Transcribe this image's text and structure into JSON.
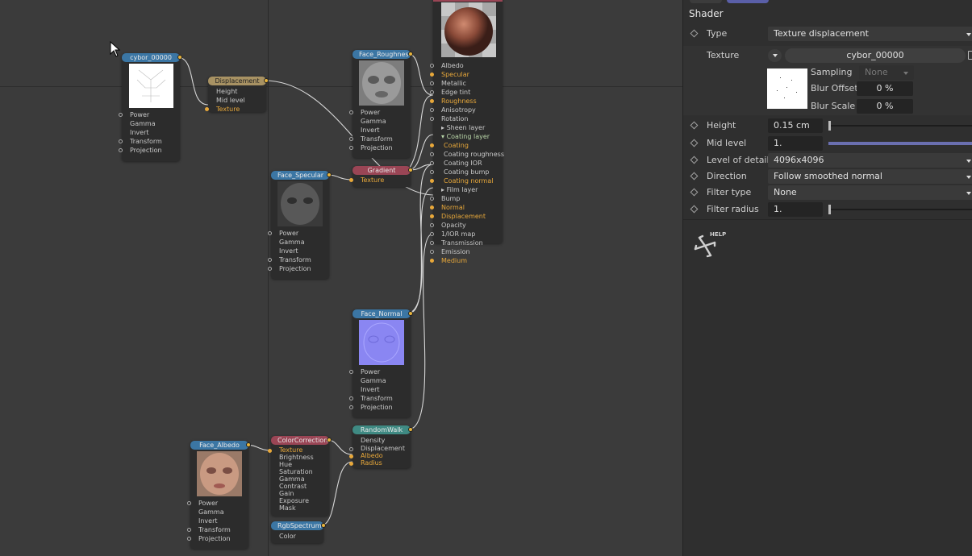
{
  "editor": {
    "nodes": {
      "cybor": {
        "title": "cybor_00000",
        "ports": [
          "Power",
          "Gamma",
          "Invert",
          "Transform",
          "Projection"
        ]
      },
      "displacement": {
        "title": "Displacement",
        "ports": [
          "Height",
          "Mid level",
          "Texture"
        ]
      },
      "face_roughness": {
        "title": "Face_Roughness",
        "ports": [
          "Power",
          "Gamma",
          "Invert",
          "Transform",
          "Projection"
        ]
      },
      "face_specular": {
        "title": "Face_Specular",
        "ports": [
          "Power",
          "Gamma",
          "Invert",
          "Transform",
          "Projection"
        ]
      },
      "gradient": {
        "title": "Gradient",
        "ports": [
          "Texture"
        ]
      },
      "material": {
        "ports": [
          "Albedo",
          "Specular",
          "Metallic",
          "Edge tint",
          "Roughness",
          "Anisotropy",
          "Rotation",
          "Sheen layer",
          "Coating layer",
          "Coating",
          "Coating roughness",
          "Coating IOR",
          "Coating bump",
          "Coating normal",
          "Film layer",
          "Bump",
          "Normal",
          "Displacement",
          "Opacity",
          "1/IOR map",
          "Transmission",
          "Emission",
          "Medium"
        ]
      },
      "face_normal": {
        "title": "Face_Normal",
        "ports": [
          "Power",
          "Gamma",
          "Invert",
          "Transform",
          "Projection"
        ]
      },
      "random_walk": {
        "title": "RandomWalk",
        "ports": [
          "Density",
          "Displacement",
          "Albedo",
          "Radius"
        ]
      },
      "face_albedo": {
        "title": "Face_Albedo",
        "ports": [
          "Power",
          "Gamma",
          "Invert",
          "Transform",
          "Projection"
        ]
      },
      "color_correction": {
        "title": "ColorCorrection",
        "ports": [
          "Texture",
          "Brightness",
          "Hue",
          "Saturation",
          "Gamma",
          "Contrast",
          "Gain",
          "Exposure",
          "Mask"
        ]
      },
      "rgb_spectrum": {
        "title": "RgbSpectrum",
        "ports": [
          "Color"
        ]
      }
    }
  },
  "panel": {
    "title": "Shader",
    "type": {
      "label": "Type",
      "value": "Texture displacement"
    },
    "texture": {
      "label": "Texture",
      "value": "cybor_00000"
    },
    "sampling": {
      "label": "Sampling",
      "value": "None"
    },
    "blur_offset": {
      "label": "Blur Offset",
      "value": "0 %"
    },
    "blur_scale": {
      "label": "Blur Scale",
      "value": "0 %"
    },
    "height": {
      "label": "Height",
      "value": "0.15 cm"
    },
    "mid_level": {
      "label": "Mid level",
      "value": "1."
    },
    "level_of_detail": {
      "label": "Level of detail",
      "value": "4096x4096"
    },
    "direction": {
      "label": "Direction",
      "value": "Follow smoothed normal"
    },
    "filter_type": {
      "label": "Filter type",
      "value": "None"
    },
    "filter_radius": {
      "label": "Filter radius",
      "value": "1."
    },
    "help_label": "HELP"
  },
  "colors": {
    "accent": "#5a5fa8",
    "wire": "#d8d8d8",
    "port_highlight": "#e8a83a",
    "node_header": "#3b76a4"
  }
}
